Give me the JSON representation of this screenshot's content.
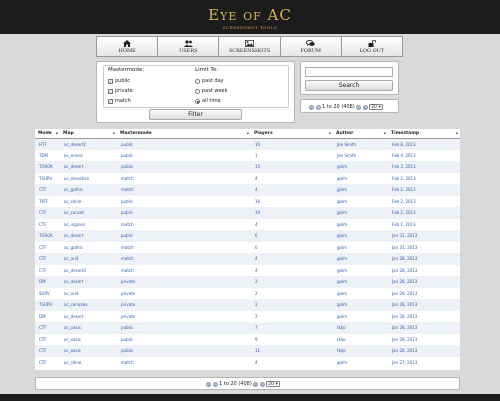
{
  "header": {
    "title": "Eye of AC",
    "subtitle": "SCREENSHOT TOOLS"
  },
  "nav": [
    {
      "label": "HOME",
      "icon": "home-icon"
    },
    {
      "label": "USERS",
      "icon": "users-icon"
    },
    {
      "label": "SCREENSHOTS",
      "icon": "image-icon"
    },
    {
      "label": "FORUM",
      "icon": "comments-icon"
    },
    {
      "label": "LOG OUT",
      "icon": "unlock-icon"
    }
  ],
  "filter": {
    "mastermode_label": "Mastermode:",
    "mastermode_options": [
      {
        "label": "public",
        "checked": true
      },
      {
        "label": "private",
        "checked": true
      },
      {
        "label": "match",
        "checked": true
      }
    ],
    "limit_label": "Limit To:",
    "limit_options": [
      {
        "label": "past day",
        "selected": false
      },
      {
        "label": "past week",
        "selected": false
      },
      {
        "label": "all time",
        "selected": true
      }
    ],
    "button": "Filter"
  },
  "search": {
    "value": "",
    "button": "Search"
  },
  "pager": {
    "range": "1 to 20 (408)",
    "page_size": "20"
  },
  "table": {
    "columns": [
      "Mode",
      "Map",
      "Mastermode",
      "Players",
      "Author",
      "Timestamp"
    ],
    "rows": [
      [
        "HTF",
        "ac_desert2",
        "public",
        "10",
        "Joe Smith",
        "Feb 8, 2013"
      ],
      [
        "TDM",
        "ac_mines",
        "public",
        "1",
        "Joe Smith",
        "Feb 4, 2013"
      ],
      [
        "TOSOK",
        "ac_desert",
        "public",
        "15",
        "golm",
        "Feb 3, 2013"
      ],
      [
        "TSURV",
        "ac_elevation",
        "match",
        "4",
        "golm",
        "Feb 2, 2013"
      ],
      [
        "CTF",
        "ac_gothic",
        "match",
        "4",
        "golm",
        "Feb 2, 2013"
      ],
      [
        "TKTF",
        "ac_shine",
        "public",
        "16",
        "golm",
        "Feb 2, 2013"
      ],
      [
        "CTF",
        "ac_sunset",
        "public",
        "19",
        "golm",
        "Feb 2, 2013"
      ],
      [
        "CTF",
        "ac_ingress",
        "match",
        "4",
        "golm",
        "Feb 1, 2013"
      ],
      [
        "TOSOK",
        "ac_desert",
        "public",
        "6",
        "golm",
        "Jan 31, 2013"
      ],
      [
        "CTF",
        "ac_gothic",
        "match",
        "6",
        "golm",
        "Jan 31, 2013"
      ],
      [
        "CTF",
        "ac_arid",
        "match",
        "4",
        "golm",
        "Jan 28, 2013"
      ],
      [
        "CTF",
        "ac_desert3",
        "match",
        "4",
        "golm",
        "Jan 28, 2013"
      ],
      [
        "DM",
        "ac_desert",
        "private",
        "2",
        "golm",
        "Jan 28, 2013"
      ],
      [
        "SURV",
        "ac_arid",
        "private",
        "2",
        "golm",
        "Jan 28, 2013"
      ],
      [
        "TSURV",
        "ac_complex",
        "private",
        "2",
        "golm",
        "Jan 28, 2013"
      ],
      [
        "DM",
        "ac_desert",
        "private",
        "2",
        "golm",
        "Jan 28, 2013"
      ],
      [
        "CTF",
        "ac_oasis",
        "public",
        "7",
        "tkljo",
        "Jan 28, 2013"
      ],
      [
        "CTF",
        "ac_oasis",
        "public",
        "9",
        "tkljo",
        "Jan 28, 2013"
      ],
      [
        "CTF",
        "ac_oasis",
        "public",
        "11",
        "tkljo",
        "Jan 28, 2013"
      ],
      [
        "CTF",
        "ac_shine",
        "match",
        "4",
        "golm",
        "Jan 27, 2013"
      ]
    ]
  }
}
